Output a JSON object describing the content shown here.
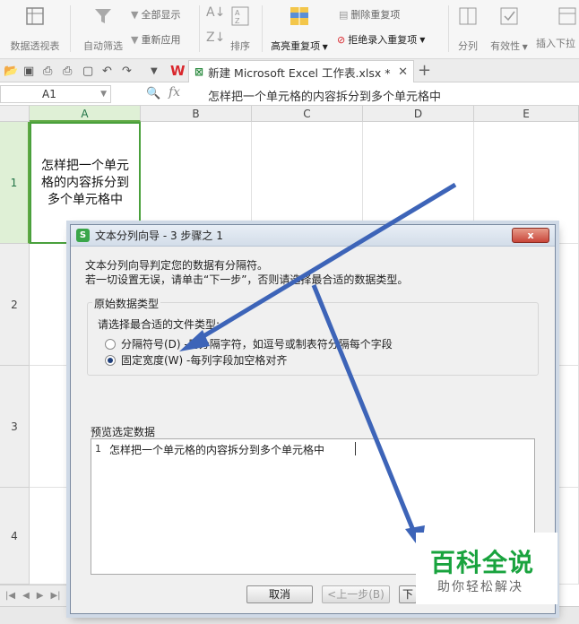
{
  "ribbon": {
    "pivot_table": "数据透视表",
    "auto_filter": "自动筛选",
    "show_all": "全部显示",
    "reapply": "重新应用",
    "sort": "排序",
    "highlight_dup": "高亮重复项",
    "remove_dup": "删除重复项",
    "reject_dup": "拒绝录入重复项",
    "split": "分列",
    "validity": "有效性",
    "insert_dropdown": "插入下拉"
  },
  "tabs": {
    "file_tab": "新建 Microsoft Excel 工作表.xlsx *"
  },
  "formula_bar": {
    "name_box": "A1",
    "fx": "fx",
    "content": "怎样把一个单元格的内容拆分到多个单元格中"
  },
  "grid": {
    "columns": [
      "A",
      "B",
      "C",
      "D",
      "E"
    ],
    "rows": [
      "1",
      "2",
      "3",
      "4"
    ],
    "cell_a1": "怎样把一个单元格的内容拆分到多个单元格中"
  },
  "dialog": {
    "title": "文本分列向导 - 3 步骤之 1",
    "close": "x",
    "line1": "文本分列向导判定您的数据有分隔符。",
    "line2": "若一切设置无误，请单击“下一步”，否则请选择最合适的数据类型。",
    "group_title": "原始数据类型",
    "choose_type": "请选择最合适的文件类型:",
    "option_delimited": "分隔符号(D) -用分隔字符，如逗号或制表符分隔每个字段",
    "option_fixed": "固定宽度(W) -每列字段加空格对齐",
    "preview_label": "预览选定数据",
    "preview_line_no": "1",
    "preview_text": "怎样把一个单元格的内容拆分到多个单元格中",
    "cancel": "取消",
    "back": "<上一步(B)",
    "next": "下"
  },
  "watermark": {
    "title": "百科全说",
    "subtitle": "助你轻松解决"
  },
  "colors": {
    "selection_green": "#4aa03c",
    "arrow_blue": "#3d64b8",
    "watermark_green": "#19a33e"
  }
}
